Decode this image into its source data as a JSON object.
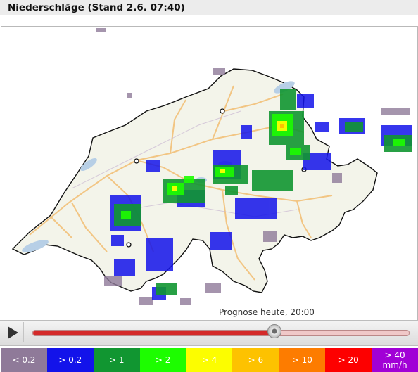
{
  "header": {
    "title": "Niederschläge (Stand 2.6. 07:40)"
  },
  "map": {
    "forecast_label": "Prognose heute, 20:00",
    "background_color": "#f3f4ea",
    "border_color": "#111111",
    "road_color": "#f2c078",
    "lake_color": "#b7cfe6"
  },
  "controls": {
    "play_icon": "play-icon",
    "timeline_progress": 0.64
  },
  "legend": [
    {
      "label": "< 0.2",
      "sub": "",
      "color": "#8f7a99"
    },
    {
      "label": "> 0.2",
      "sub": "",
      "color": "#1313ea"
    },
    {
      "label": "> 1",
      "sub": "",
      "color": "#119631"
    },
    {
      "label": "> 2",
      "sub": "",
      "color": "#1dfd00"
    },
    {
      "label": "> 4",
      "sub": "",
      "color": "#fcfd00"
    },
    {
      "label": "> 6",
      "sub": "",
      "color": "#fdc200"
    },
    {
      "label": "> 10",
      "sub": "",
      "color": "#fd7c00"
    },
    {
      "label": "> 20",
      "sub": "",
      "color": "#fd0000"
    },
    {
      "label": "> 40",
      "sub": "mm/h",
      "color": "#a100d6"
    }
  ]
}
